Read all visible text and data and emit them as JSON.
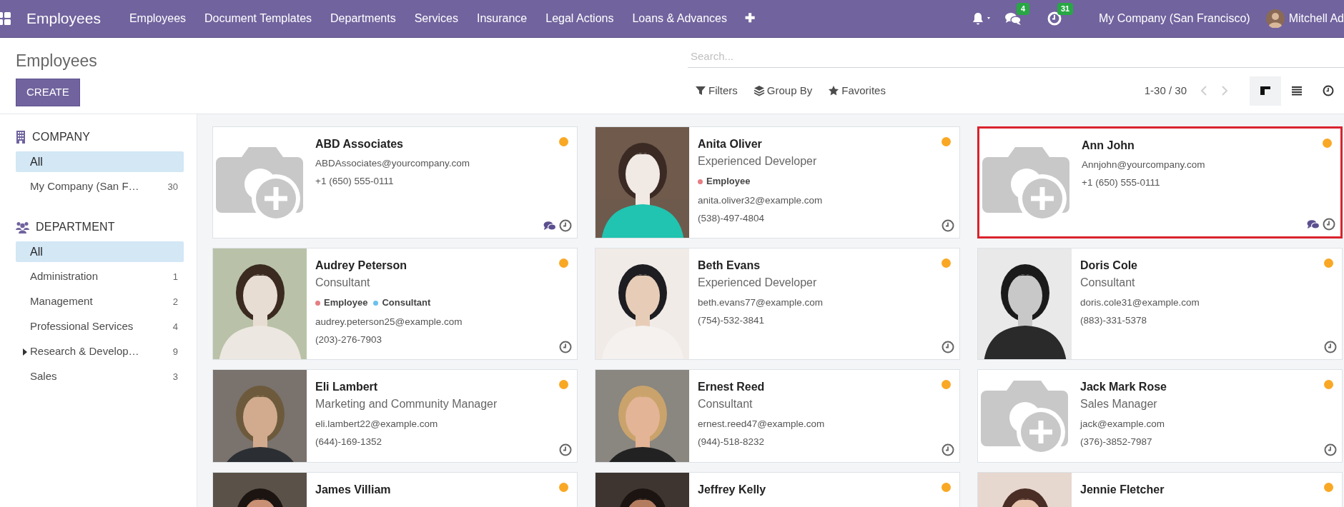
{
  "navbar": {
    "app_name": "Employees",
    "menu": [
      "Employees",
      "Document Templates",
      "Departments",
      "Services",
      "Insurance",
      "Legal Actions",
      "Loans & Advances"
    ],
    "add_symbol": "✚",
    "messages_count": "4",
    "activities_count": "31",
    "company": "My Company (San Francisco)",
    "user": "Mitchell Ad"
  },
  "control_panel": {
    "title": "Employees",
    "create_button": "CREATE",
    "search": {
      "placeholder": "Search..."
    },
    "filters": [
      {
        "label": "Filters",
        "kind": "filter"
      },
      {
        "label": "Group By",
        "kind": "group"
      },
      {
        "label": "Favorites",
        "kind": "star"
      }
    ],
    "pager": "1-30 / 30",
    "views": [
      {
        "kind": "kanban",
        "selected": true
      },
      {
        "kind": "list",
        "selected": false
      },
      {
        "kind": "activity",
        "selected": false
      }
    ]
  },
  "sidebar": {
    "sections": [
      {
        "title": "COMPANY",
        "kind": "company",
        "items": [
          {
            "label": "All",
            "selected": true,
            "expandable": false
          },
          {
            "label": "My Company (San F…",
            "count": "30",
            "selected": false,
            "expandable": false
          }
        ]
      },
      {
        "title": "DEPARTMENT",
        "kind": "department",
        "items": [
          {
            "label": "All",
            "selected": true,
            "expandable": false
          },
          {
            "label": "Administration",
            "count": "1",
            "selected": false,
            "expandable": false
          },
          {
            "label": "Management",
            "count": "2",
            "selected": false,
            "expandable": false
          },
          {
            "label": "Professional Services",
            "count": "4",
            "selected": false,
            "expandable": false
          },
          {
            "label": "Research & Develop…",
            "count": "9",
            "selected": false,
            "expandable": true
          },
          {
            "label": "Sales",
            "count": "3",
            "selected": false,
            "expandable": false
          }
        ]
      }
    ]
  },
  "cards": [
    {
      "name": "ABD Associates",
      "email": "ABDAssociates@yourcompany.com",
      "phone": "+1 (650) 555-0111",
      "has_photo": false,
      "away": true,
      "has_messages": true,
      "highlighted": false
    },
    {
      "name": "Anita Oliver",
      "job_title": "Experienced Developer",
      "tags": [
        {
          "label": "Employee",
          "color": "#e57f83"
        }
      ],
      "email": "anita.oliver32@example.com",
      "phone": "(538)-497-4804",
      "has_photo": true,
      "away": true,
      "has_messages": false,
      "highlighted": false
    },
    {
      "name": "Ann John",
      "email": "Annjohn@yourcompany.com",
      "phone": "+1 (650) 555-0111",
      "has_photo": false,
      "away": true,
      "has_messages": true,
      "highlighted": true
    },
    {
      "name": "Audrey Peterson",
      "job_title": "Consultant",
      "tags": [
        {
          "label": "Employee",
          "color": "#e57f83"
        },
        {
          "label": "Consultant",
          "color": "#6cc1ed"
        }
      ],
      "email": "audrey.peterson25@example.com",
      "phone": "(203)-276-7903",
      "has_photo": true,
      "away": true,
      "has_messages": false,
      "highlighted": false
    },
    {
      "name": "Beth Evans",
      "job_title": "Experienced Developer",
      "email": "beth.evans77@example.com",
      "phone": "(754)-532-3841",
      "has_photo": true,
      "away": true,
      "has_messages": false,
      "highlighted": false
    },
    {
      "name": "Doris Cole",
      "job_title": "Consultant",
      "email": "doris.cole31@example.com",
      "phone": "(883)-331-5378",
      "has_photo": true,
      "away": true,
      "has_messages": false,
      "highlighted": false
    },
    {
      "name": "Eli Lambert",
      "job_title": "Marketing and Community Manager",
      "email": "eli.lambert22@example.com",
      "phone": "(644)-169-1352",
      "has_photo": true,
      "away": true,
      "has_messages": false,
      "highlighted": false
    },
    {
      "name": "Ernest Reed",
      "job_title": "Consultant",
      "email": "ernest.reed47@example.com",
      "phone": "(944)-518-8232",
      "has_photo": true,
      "away": true,
      "has_messages": false,
      "highlighted": false
    },
    {
      "name": "Jack Mark Rose",
      "job_title": "Sales Manager",
      "email": "jack@example.com",
      "phone": "(376)-3852-7987",
      "has_photo": false,
      "away": true,
      "has_messages": false,
      "highlighted": false
    },
    {
      "name": "James Villiam",
      "has_photo": true,
      "away": true,
      "highlighted": false
    },
    {
      "name": "Jeffrey Kelly",
      "has_photo": true,
      "away": true,
      "highlighted": false
    },
    {
      "name": "Jennie Fletcher",
      "has_photo": true,
      "away": true,
      "highlighted": false
    }
  ]
}
